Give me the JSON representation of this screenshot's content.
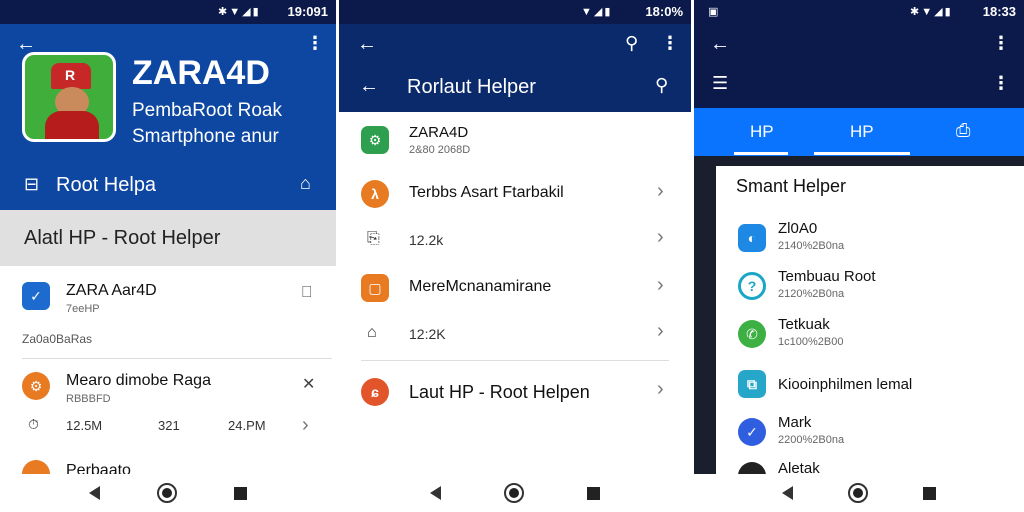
{
  "status": {
    "p1_time": "19:091",
    "p2_time": "18:0%",
    "p3_time": "18:33"
  },
  "screen1": {
    "app_name": "ZARA4D",
    "tagline_1": "PembaRoot Roak",
    "tagline_2": "Smartphone anur",
    "nav_label": "Root Helpa",
    "section_title": "Alatl HP - Root Helper",
    "item1": {
      "title": "ZARA Aar4D",
      "sub": "7eeHP"
    },
    "meta": "Za0a0BaRas",
    "item2": {
      "title": "Mearo dimobe Raga",
      "sub": "RBBBFD"
    },
    "stats": [
      "12.5M",
      "321",
      "24.PM"
    ],
    "item3": {
      "title": "Perbaato"
    },
    "colors": {
      "header": "#0d47a1",
      "accent": "#e87a22"
    }
  },
  "screen2": {
    "toolbar_title": "Rorlaut Helper",
    "items": [
      {
        "title": "ZARA4D",
        "sub": "2&80 2068D"
      },
      {
        "title": "Terbbs Asart Ftarbakil"
      },
      {
        "title": "12.2k"
      },
      {
        "title": "MereMcnanamirane"
      },
      {
        "title": "12:2K"
      },
      {
        "title": "Laut HP - Root Helpen"
      }
    ],
    "colors": {
      "header": "#0b2a6b",
      "accent": "#e87a22"
    }
  },
  "screen3": {
    "tabs": [
      "HP",
      "HP"
    ],
    "section_title": "Smant Helper",
    "items": [
      {
        "title": "Zl0A0",
        "sub": "2140%2B0na"
      },
      {
        "title": "Tembuau Root",
        "sub": "2120%2B0na"
      },
      {
        "title": "Tetkuak",
        "sub": "1c100%2B00"
      },
      {
        "title": "Kiooinphilmen lemal",
        "sub": ""
      },
      {
        "title": "Mark",
        "sub": "2200%2B0na"
      },
      {
        "title": "Aletak",
        "sub": ""
      }
    ],
    "colors": {
      "header": "#0b1a4a",
      "tabs": "#0a74ff"
    }
  },
  "icons": [
    "back-arrow-icon",
    "more-vert-icon",
    "search-icon",
    "home-icon",
    "bookmark-icon",
    "share-icon",
    "chevron-right-icon",
    "menu-icon"
  ]
}
